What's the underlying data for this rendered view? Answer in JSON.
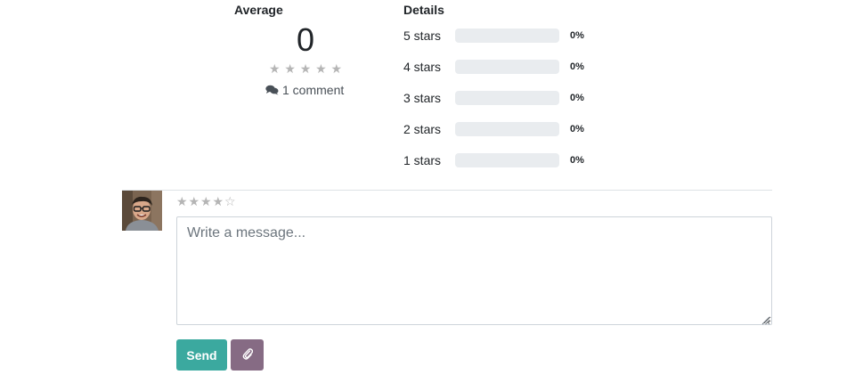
{
  "ratings": {
    "average_heading": "Average",
    "average_value": "0",
    "average_stars": [
      "★",
      "★",
      "★",
      "★",
      "★"
    ],
    "comment_count_text": "1 comment",
    "details_heading": "Details",
    "rows": [
      {
        "label": "5 stars",
        "percent_text": "0%",
        "percent": 0
      },
      {
        "label": "4 stars",
        "percent_text": "0%",
        "percent": 0
      },
      {
        "label": "3 stars",
        "percent_text": "0%",
        "percent": 0
      },
      {
        "label": "2 stars",
        "percent_text": "0%",
        "percent": 0
      },
      {
        "label": "1 stars",
        "percent_text": "0%",
        "percent": 0
      }
    ]
  },
  "composer": {
    "rating_value": 4,
    "rating_max": 5,
    "message_placeholder": "Write a message...",
    "send_label": "Send",
    "attach_icon": "paperclip-icon"
  },
  "colors": {
    "send_button": "#3ba99f",
    "attach_button": "#866b84",
    "bar_track": "#e9ecef",
    "star_filled": "#b5b5b5"
  }
}
